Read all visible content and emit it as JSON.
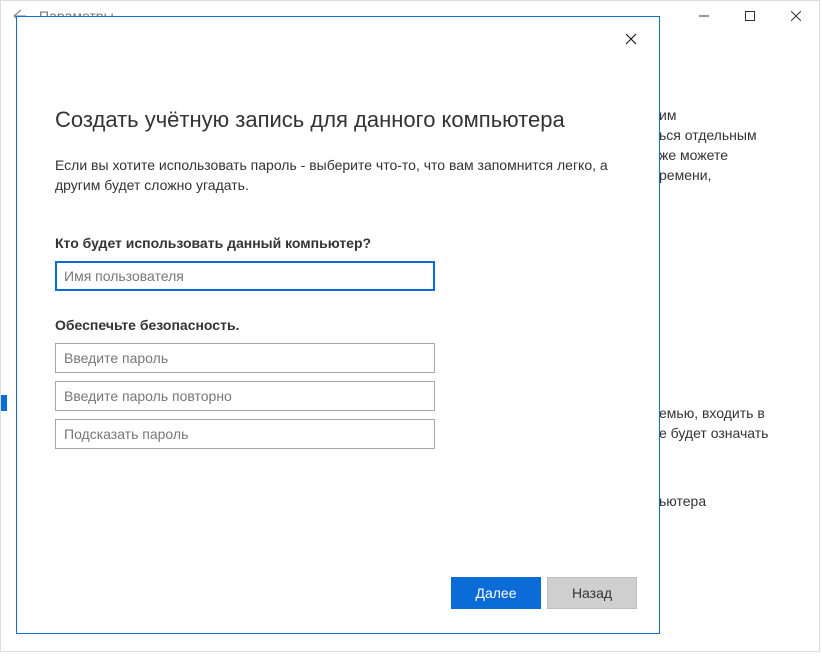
{
  "underlay": {
    "title": "Параметры",
    "fragments": {
      "f1": "им",
      "f2": "ься отдельным",
      "f3": "же можете",
      "f4": "ремени,",
      "f5": "емью, входить в",
      "f6": "е будет означать",
      "f7": "ьютера"
    }
  },
  "dialog": {
    "heading": "Создать учётную запись для данного компьютера",
    "intro": "Если вы хотите использовать пароль - выберите что-то, что вам запомнится легко, а другим будет сложно угадать.",
    "section_user": "Кто будет использовать данный компьютер?",
    "username_placeholder": "Имя пользователя",
    "section_security": "Обеспечьте безопасность.",
    "password_placeholder": "Введите пароль",
    "password2_placeholder": "Введите пароль повторно",
    "hint_placeholder": "Подсказать пароль",
    "primary_btn": "Далее",
    "secondary_btn": "Назад"
  }
}
